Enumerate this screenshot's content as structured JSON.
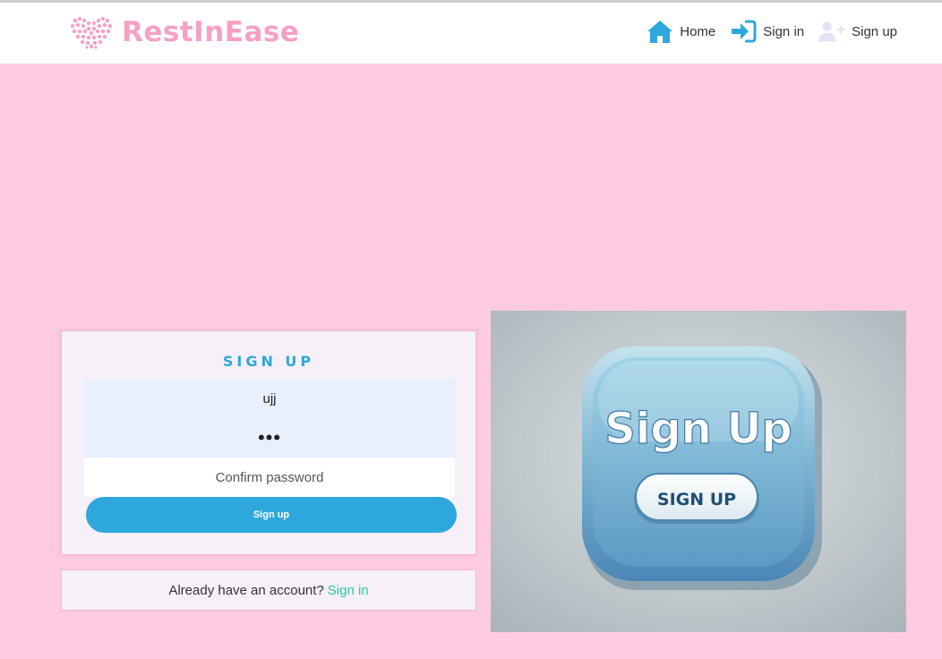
{
  "brand": {
    "name": "RestInEase",
    "logo_icon": "heart-logo-icon",
    "color": "#f7a0c6"
  },
  "nav": {
    "home": {
      "label": "Home",
      "icon": "home-icon"
    },
    "signin": {
      "label": "Sign in",
      "icon": "sign-in-icon"
    },
    "signup": {
      "label": "Sign up",
      "icon": "user-plus-icon"
    }
  },
  "form": {
    "title": "SIGN UP",
    "username_value": "ujj",
    "password_value": "•••",
    "confirm_placeholder": "Confirm password",
    "submit_label": "Sign up"
  },
  "signin_prompt": {
    "text": "Already have an account?",
    "link": "Sign in"
  },
  "hero": {
    "heading": "Sign Up",
    "button": "SIGN UP"
  },
  "colors": {
    "background": "#fecbe0",
    "accent": "#2ea8dc",
    "link": "#2ec8a0"
  }
}
